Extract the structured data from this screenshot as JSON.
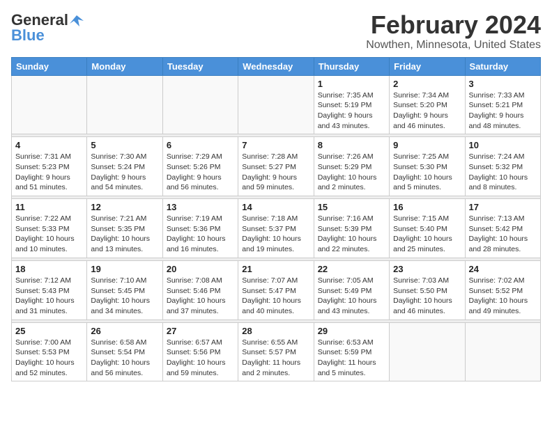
{
  "header": {
    "logo_general": "General",
    "logo_blue": "Blue",
    "title": "February 2024",
    "location": "Nowthen, Minnesota, United States"
  },
  "weekdays": [
    "Sunday",
    "Monday",
    "Tuesday",
    "Wednesday",
    "Thursday",
    "Friday",
    "Saturday"
  ],
  "weeks": [
    [
      {
        "day": "",
        "info": ""
      },
      {
        "day": "",
        "info": ""
      },
      {
        "day": "",
        "info": ""
      },
      {
        "day": "",
        "info": ""
      },
      {
        "day": "1",
        "info": "Sunrise: 7:35 AM\nSunset: 5:19 PM\nDaylight: 9 hours\nand 43 minutes."
      },
      {
        "day": "2",
        "info": "Sunrise: 7:34 AM\nSunset: 5:20 PM\nDaylight: 9 hours\nand 46 minutes."
      },
      {
        "day": "3",
        "info": "Sunrise: 7:33 AM\nSunset: 5:21 PM\nDaylight: 9 hours\nand 48 minutes."
      }
    ],
    [
      {
        "day": "4",
        "info": "Sunrise: 7:31 AM\nSunset: 5:23 PM\nDaylight: 9 hours\nand 51 minutes."
      },
      {
        "day": "5",
        "info": "Sunrise: 7:30 AM\nSunset: 5:24 PM\nDaylight: 9 hours\nand 54 minutes."
      },
      {
        "day": "6",
        "info": "Sunrise: 7:29 AM\nSunset: 5:26 PM\nDaylight: 9 hours\nand 56 minutes."
      },
      {
        "day": "7",
        "info": "Sunrise: 7:28 AM\nSunset: 5:27 PM\nDaylight: 9 hours\nand 59 minutes."
      },
      {
        "day": "8",
        "info": "Sunrise: 7:26 AM\nSunset: 5:29 PM\nDaylight: 10 hours\nand 2 minutes."
      },
      {
        "day": "9",
        "info": "Sunrise: 7:25 AM\nSunset: 5:30 PM\nDaylight: 10 hours\nand 5 minutes."
      },
      {
        "day": "10",
        "info": "Sunrise: 7:24 AM\nSunset: 5:32 PM\nDaylight: 10 hours\nand 8 minutes."
      }
    ],
    [
      {
        "day": "11",
        "info": "Sunrise: 7:22 AM\nSunset: 5:33 PM\nDaylight: 10 hours\nand 10 minutes."
      },
      {
        "day": "12",
        "info": "Sunrise: 7:21 AM\nSunset: 5:35 PM\nDaylight: 10 hours\nand 13 minutes."
      },
      {
        "day": "13",
        "info": "Sunrise: 7:19 AM\nSunset: 5:36 PM\nDaylight: 10 hours\nand 16 minutes."
      },
      {
        "day": "14",
        "info": "Sunrise: 7:18 AM\nSunset: 5:37 PM\nDaylight: 10 hours\nand 19 minutes."
      },
      {
        "day": "15",
        "info": "Sunrise: 7:16 AM\nSunset: 5:39 PM\nDaylight: 10 hours\nand 22 minutes."
      },
      {
        "day": "16",
        "info": "Sunrise: 7:15 AM\nSunset: 5:40 PM\nDaylight: 10 hours\nand 25 minutes."
      },
      {
        "day": "17",
        "info": "Sunrise: 7:13 AM\nSunset: 5:42 PM\nDaylight: 10 hours\nand 28 minutes."
      }
    ],
    [
      {
        "day": "18",
        "info": "Sunrise: 7:12 AM\nSunset: 5:43 PM\nDaylight: 10 hours\nand 31 minutes."
      },
      {
        "day": "19",
        "info": "Sunrise: 7:10 AM\nSunset: 5:45 PM\nDaylight: 10 hours\nand 34 minutes."
      },
      {
        "day": "20",
        "info": "Sunrise: 7:08 AM\nSunset: 5:46 PM\nDaylight: 10 hours\nand 37 minutes."
      },
      {
        "day": "21",
        "info": "Sunrise: 7:07 AM\nSunset: 5:47 PM\nDaylight: 10 hours\nand 40 minutes."
      },
      {
        "day": "22",
        "info": "Sunrise: 7:05 AM\nSunset: 5:49 PM\nDaylight: 10 hours\nand 43 minutes."
      },
      {
        "day": "23",
        "info": "Sunrise: 7:03 AM\nSunset: 5:50 PM\nDaylight: 10 hours\nand 46 minutes."
      },
      {
        "day": "24",
        "info": "Sunrise: 7:02 AM\nSunset: 5:52 PM\nDaylight: 10 hours\nand 49 minutes."
      }
    ],
    [
      {
        "day": "25",
        "info": "Sunrise: 7:00 AM\nSunset: 5:53 PM\nDaylight: 10 hours\nand 52 minutes."
      },
      {
        "day": "26",
        "info": "Sunrise: 6:58 AM\nSunset: 5:54 PM\nDaylight: 10 hours\nand 56 minutes."
      },
      {
        "day": "27",
        "info": "Sunrise: 6:57 AM\nSunset: 5:56 PM\nDaylight: 10 hours\nand 59 minutes."
      },
      {
        "day": "28",
        "info": "Sunrise: 6:55 AM\nSunset: 5:57 PM\nDaylight: 11 hours\nand 2 minutes."
      },
      {
        "day": "29",
        "info": "Sunrise: 6:53 AM\nSunset: 5:59 PM\nDaylight: 11 hours\nand 5 minutes."
      },
      {
        "day": "",
        "info": ""
      },
      {
        "day": "",
        "info": ""
      }
    ]
  ]
}
